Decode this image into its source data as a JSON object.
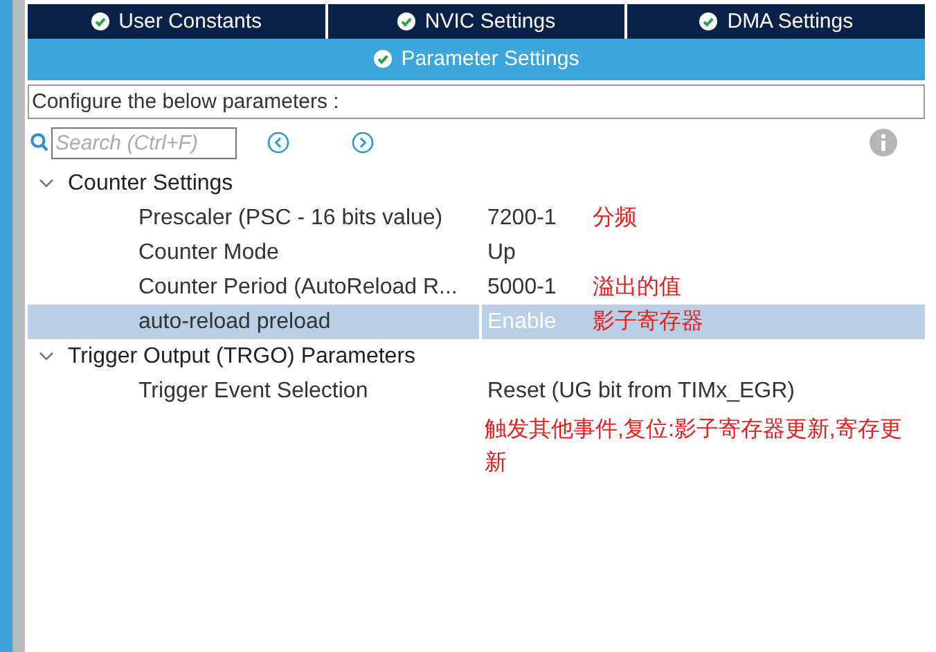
{
  "tabs": [
    {
      "label": "User Constants",
      "selected": false
    },
    {
      "label": "NVIC Settings",
      "selected": false
    },
    {
      "label": "DMA Settings",
      "selected": false
    },
    {
      "label": "Parameter Settings",
      "selected": true
    }
  ],
  "description": "Configure the below parameters :",
  "search": {
    "placeholder": "Search (Ctrl+F)"
  },
  "tree": [
    {
      "label": "Counter Settings",
      "expanded": true,
      "children": [
        {
          "label": "Prescaler (PSC - 16 bits value)",
          "value": "7200-1",
          "selected": false,
          "note": "分频"
        },
        {
          "label": "Counter Mode",
          "value": "Up",
          "selected": false
        },
        {
          "label": "Counter Period (AutoReload R...",
          "value": "5000-1",
          "selected": false,
          "note": "溢出的值"
        },
        {
          "label": "auto-reload preload",
          "value": "Enable",
          "selected": true,
          "note": "影子寄存器"
        }
      ]
    },
    {
      "label": "Trigger Output (TRGO) Parameters",
      "expanded": true,
      "children": [
        {
          "label": "Trigger Event Selection",
          "value": "Reset (UG bit from TIMx_EGR)",
          "selected": false,
          "note_below": "触发其他事件,复位:影子寄存器更新,寄存更新"
        }
      ]
    }
  ]
}
